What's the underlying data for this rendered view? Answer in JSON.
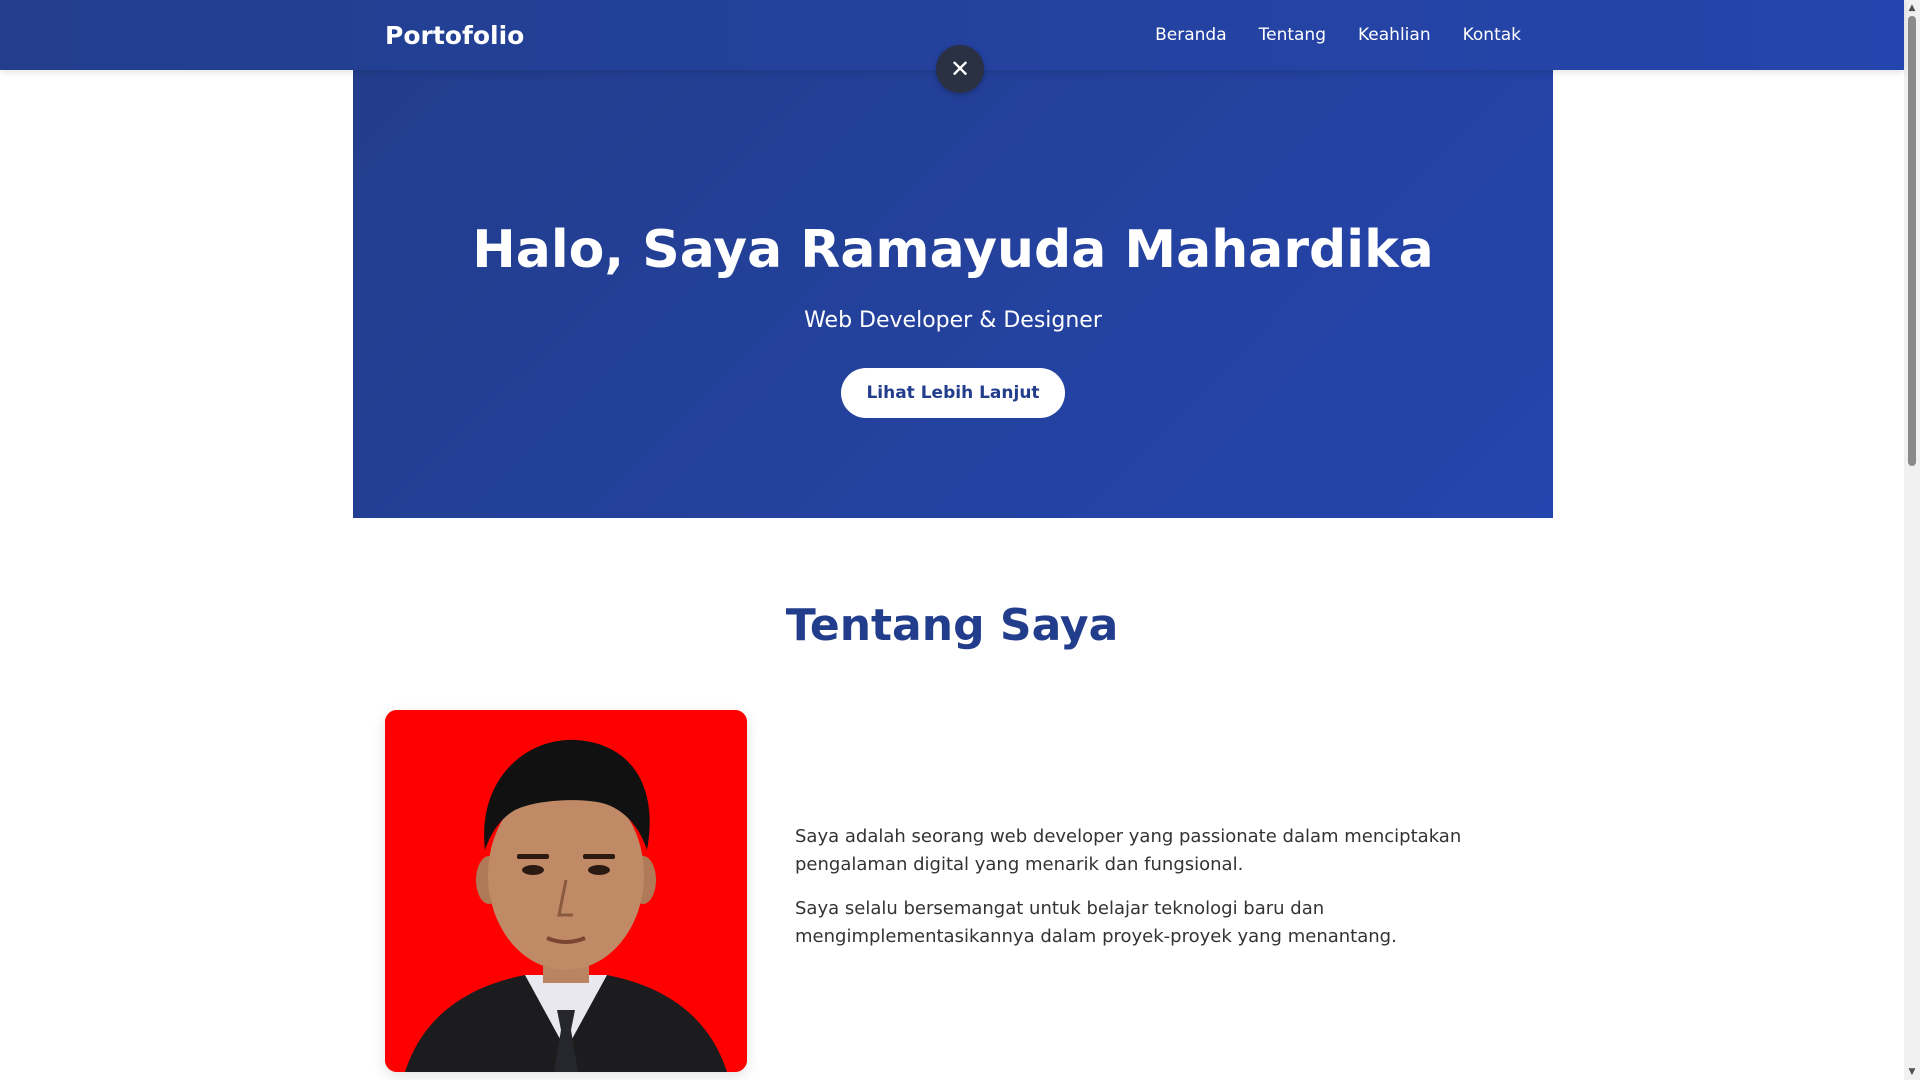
{
  "navbar": {
    "brand": "Portofolio",
    "links": [
      "Beranda",
      "Tentang",
      "Keahlian",
      "Kontak"
    ]
  },
  "overlay": {
    "close_icon": "close-icon",
    "close_symbol": "✕"
  },
  "hero": {
    "title": "Halo, Saya Ramayuda Mahardika",
    "subtitle": "Web Developer & Designer",
    "cta_label": "Lihat Lebih Lanjut"
  },
  "about": {
    "title": "Tentang Saya",
    "paragraphs": [
      "Saya adalah seorang web developer yang passionate dalam menciptakan pengalaman digital yang menarik dan fungsional.",
      "Saya selalu bersemangat untuk belajar teknologi baru dan mengimplementasikannya dalam proyek-proyek yang menantang."
    ]
  },
  "colors": {
    "primary": "#223d8b",
    "primary_light": "#2545ae",
    "photo_background": "#ff0000"
  }
}
